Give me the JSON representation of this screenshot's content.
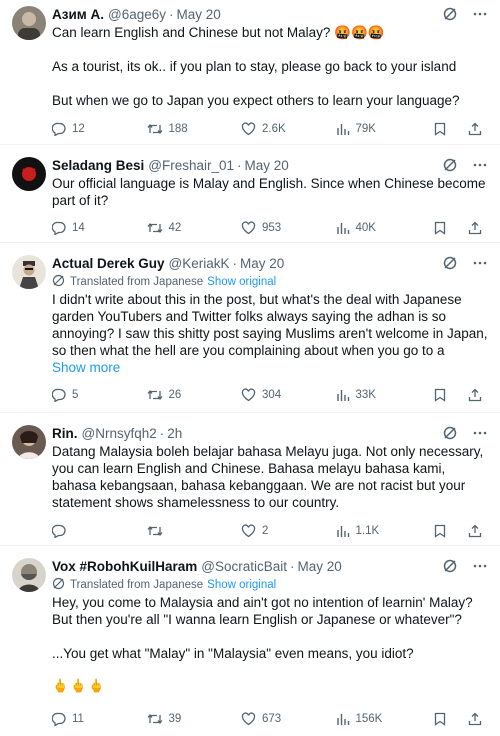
{
  "tweets": [
    {
      "name": "Азим А.",
      "handle": "@6age6y",
      "date": "May 20",
      "translated": false,
      "paragraphs": [
        "Can learn English and Chinese but not Malay? 🤬🤬🤬",
        "As a tourist, its ok.. if you plan to stay, please go back to your island",
        "But when we go to Japan you expect others to learn your language?"
      ],
      "replies": "12",
      "retweets": "188",
      "likes": "2.6K",
      "views": "79K"
    },
    {
      "name": "Seladang Besi",
      "handle": "@Freshair_01",
      "date": "May 20",
      "translated": false,
      "paragraphs": [
        "Our official language is Malay and English. Since when Chinese become part of it?"
      ],
      "replies": "14",
      "retweets": "42",
      "likes": "953",
      "views": "40K"
    },
    {
      "name": "Actual Derek Guy",
      "handle": "@KeriakK",
      "date": "May 20",
      "translated": true,
      "translated_label": "Translated from Japanese",
      "show_original": "Show original",
      "paragraphs": [
        "I didn't write about this in the post, but what's the deal with Japanese garden YouTubers and Twitter folks always saying the adhan is so annoying? I saw this shitty post saying Muslims aren't welcome in Japan, so then what the hell are you complaining about when you go to a"
      ],
      "show_more": "Show more",
      "replies": "5",
      "retweets": "26",
      "likes": "304",
      "views": "33K"
    },
    {
      "name": "Rin.",
      "handle": "@Nrnsyfqh2",
      "date": "2h",
      "translated": false,
      "paragraphs": [
        "Datang Malaysia boleh belajar bahasa Melayu juga. Not only necessary, you can learn English and Chinese. Bahasa melayu bahasa kami, bahasa kebangsaan, bahasa kebanggaan. We are not racist but your statement shows shamelessness to our country."
      ],
      "replies": "",
      "retweets": "",
      "likes": "2",
      "views": "1.1K"
    },
    {
      "name": "Vox #RobohKuilHaram",
      "handle": "@SocraticBait",
      "date": "May 20",
      "translated": true,
      "translated_label": "Translated from Japanese",
      "show_original": "Show original",
      "paragraphs": [
        "Hey, you come to Malaysia and ain't got no intention of learnin' Malay? But then you're all \"I wanna learn English or Japanese or whatever\"?",
        "...You get what \"Malay\" in \"Malaysia\" even means, you idiot?"
      ],
      "emoji_row": "🖕🖕🖕",
      "replies": "11",
      "retweets": "39",
      "likes": "673",
      "views": "156K"
    }
  ],
  "colors": {
    "text": "#0f1419",
    "muted": "#536471",
    "link": "#1d9bf0",
    "divider": "#eff3f4"
  },
  "icons": {
    "reply": "speech-bubble-icon",
    "retweet": "retweet-arrows-icon",
    "like": "heart-icon",
    "views": "bar-chart-icon",
    "bookmark": "bookmark-icon",
    "share": "share-upload-icon",
    "grok": "grok-slash-circle-icon",
    "more": "more-dots-icon",
    "translate": "translate-globe-icon"
  }
}
